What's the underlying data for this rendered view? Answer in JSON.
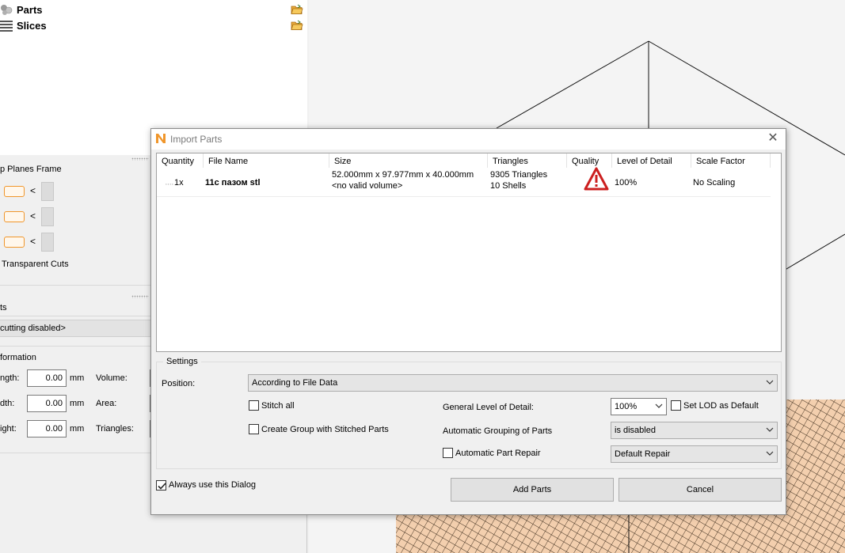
{
  "tree": {
    "parts_label": "Parts",
    "slices_label": "Slices"
  },
  "clip": {
    "section_label": "p Planes Frame",
    "arrow_glyph": "<",
    "transparent_cuts_label": "Transparent Cuts"
  },
  "cuts": {
    "section_label": "ts",
    "cutting_status": "cutting disabled>"
  },
  "info": {
    "section_label": "formation",
    "rows": [
      {
        "label": "ngth:",
        "value": "0.00",
        "unit": "mm",
        "label2": "Volume:"
      },
      {
        "label": "dth:",
        "value": "0.00",
        "unit": "mm",
        "label2": "Area:"
      },
      {
        "label": "ight:",
        "value": "0.00",
        "unit": "mm",
        "label2": "Triangles:"
      }
    ]
  },
  "dialog": {
    "title": "Import Parts",
    "close_glyph": "✕",
    "columns": {
      "quantity": "Quantity",
      "file_name": "File Name",
      "size": "Size",
      "triangles": "Triangles",
      "quality": "Quality",
      "lod": "Level of Detail",
      "scale": "Scale Factor"
    },
    "file": {
      "quantity": "1x",
      "file_name": "11с пазом stl",
      "size_line1": "52.000mm x 97.977mm x 40.000mm",
      "size_line2": "<no valid volume>",
      "triangles_line1": "9305 Triangles",
      "triangles_line2": "10 Shells",
      "lod": "100%",
      "scale": "No Scaling"
    },
    "settings": {
      "legend": "Settings",
      "position_label": "Position:",
      "position_value": "According to File Data",
      "stitch_all_label": "Stitch all",
      "create_group_label": "Create Group with Stitched Parts",
      "general_lod_label": "General Level of Detail:",
      "general_lod_value": "100%",
      "set_lod_default_label": "Set LOD as Default",
      "auto_grouping_label": "Automatic Grouping of Parts",
      "auto_grouping_value": "is disabled",
      "auto_repair_label": "Automatic Part Repair",
      "repair_value": "Default Repair"
    },
    "always_use_label": "Always use this Dialog",
    "add_parts_label": "Add Parts",
    "cancel_label": "Cancel"
  },
  "colors": {
    "accent_orange": "#f0962b",
    "warning_red": "#cc1f1f",
    "mesh_fill": "#f3cfae"
  }
}
